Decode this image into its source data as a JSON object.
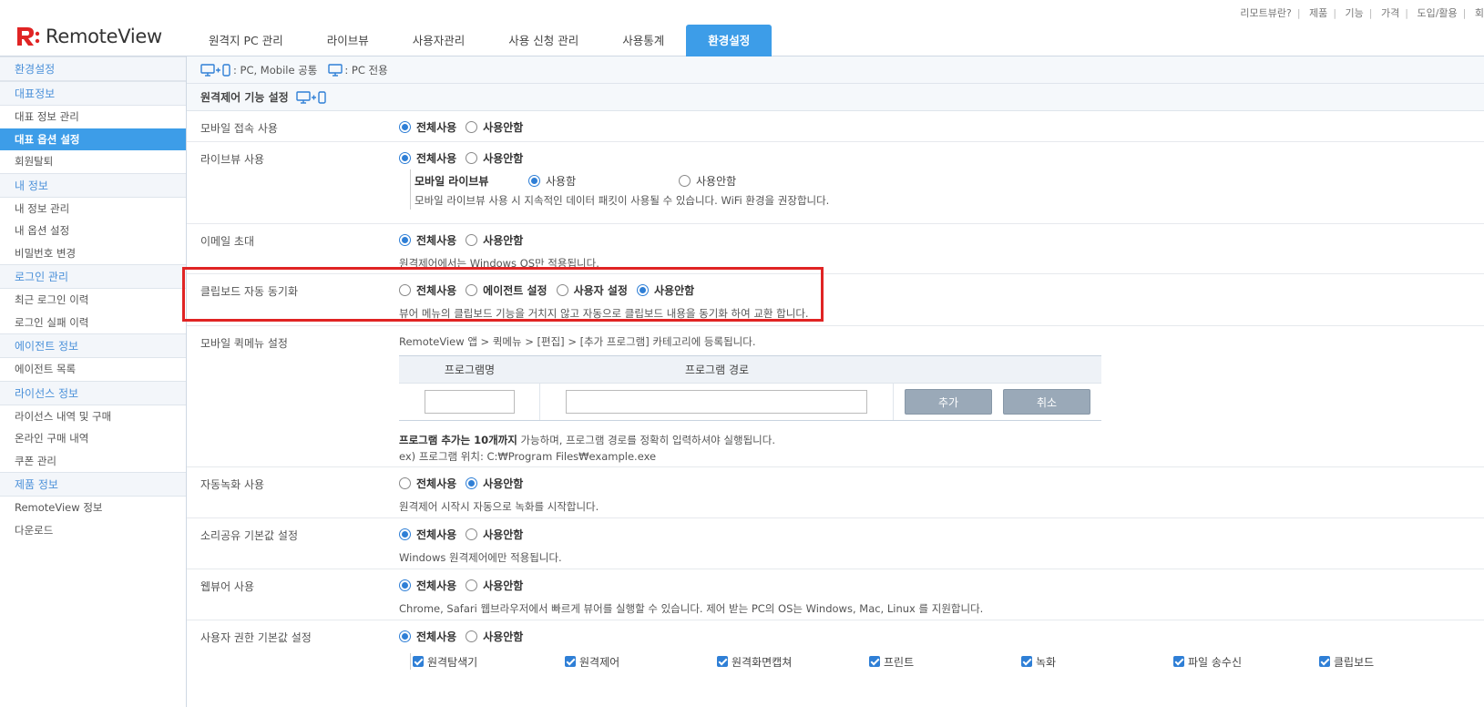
{
  "header": {
    "logo_text": "RemoteView",
    "top_links": [
      "리모트뷰란?",
      "제품",
      "기능",
      "가격",
      "도입/활용",
      "회"
    ],
    "nav": [
      {
        "label": "원격지 PC 관리",
        "active": false
      },
      {
        "label": "라이브뷰",
        "active": false
      },
      {
        "label": "사용자관리",
        "active": false
      },
      {
        "label": "사용 신청 관리",
        "active": false
      },
      {
        "label": "사용통계",
        "active": false
      },
      {
        "label": "환경설정",
        "active": true
      }
    ],
    "accent_color": "#3d9de8"
  },
  "sidebar": {
    "title": "환경설정",
    "sections": [
      {
        "title": "대표정보",
        "items": [
          {
            "label": "대표 정보 관리",
            "active": false
          },
          {
            "label": "대표 옵션 설정",
            "active": true
          },
          {
            "label": "회원탈퇴",
            "active": false
          }
        ]
      },
      {
        "title": "내 정보",
        "items": [
          {
            "label": "내 정보 관리",
            "active": false
          },
          {
            "label": "내 옵션 설정",
            "active": false
          },
          {
            "label": "비밀번호 변경",
            "active": false
          }
        ]
      },
      {
        "title": "로그인 관리",
        "items": [
          {
            "label": "최근 로그인 이력",
            "active": false
          },
          {
            "label": "로그인 실패 이력",
            "active": false
          }
        ]
      },
      {
        "title": "에이전트 정보",
        "items": [
          {
            "label": "에이전트 목록",
            "active": false
          }
        ]
      },
      {
        "title": "라이선스 정보",
        "items": [
          {
            "label": "라이선스 내역 및 구매",
            "active": false
          },
          {
            "label": "온라인 구매 내역",
            "active": false
          },
          {
            "label": "쿠폰 관리",
            "active": false
          }
        ]
      },
      {
        "title": "제품 정보",
        "items": [
          {
            "label": "RemoteView 정보",
            "active": false
          },
          {
            "label": "다운로드",
            "active": false
          }
        ]
      }
    ]
  },
  "legend": {
    "pc_mobile": ": PC, Mobile 공통",
    "pc_only": ": PC 전용"
  },
  "section_title": "원격제어 기능 설정",
  "rows": {
    "mobile_access": {
      "label": "모바일 접속 사용",
      "opt_all": "전체사용",
      "opt_none": "사용안함"
    },
    "liveview": {
      "label": "라이브뷰 사용",
      "opt_all": "전체사용",
      "opt_none": "사용안함",
      "sub_label": "모바일 라이브뷰",
      "sub_opt_use": "사용함",
      "sub_opt_none": "사용안함",
      "sub_desc": "모바일 라이브뷰 사용 시 지속적인 데이터 패킷이 사용될 수 있습니다. WiFi 환경을 권장합니다."
    },
    "email_invite": {
      "label": "이메일 초대",
      "opt_all": "전체사용",
      "opt_none": "사용안함",
      "desc": "원격제어에서는 Windows OS만 적용됩니다."
    },
    "clipboard": {
      "label": "클립보드 자동 동기화",
      "opt_all": "전체사용",
      "opt_agent": "에이전트 설정",
      "opt_user": "사용자 설정",
      "opt_none": "사용안함",
      "desc": "뷰어 메뉴의 클립보드 기능을 거치지 않고 자동으로 클립보드 내용을 동기화 하여 교환 합니다."
    },
    "quick_menu": {
      "label": "모바일 퀵메뉴 설정",
      "path": "RemoteView 앱 > 퀵메뉴 > [편집] > [추가 프로그램] 카테고리에 등록됩니다.",
      "col_name": "프로그램명",
      "col_path": "프로그램 경로",
      "add_button": "추가",
      "cancel_button": "취소",
      "note_bold": "프로그램 추가는 10개까지",
      "note_rest": " 가능하며, 프로그램 경로를 정확히 입력하셔야 실행됩니다.",
      "example": "ex) 프로그램 위치: C:₩Program Files₩example.exe"
    },
    "auto_record": {
      "label": "자동녹화 사용",
      "opt_all": "전체사용",
      "opt_none": "사용안함",
      "desc": "원격제어 시작시 자동으로 녹화를 시작합니다."
    },
    "sound_share": {
      "label": "소리공유 기본값 설정",
      "opt_all": "전체사용",
      "opt_none": "사용안함",
      "desc": "Windows 원격제어에만 적용됩니다."
    },
    "web_viewer": {
      "label": "웹뷰어 사용",
      "opt_all": "전체사용",
      "opt_none": "사용안함",
      "desc": "Chrome, Safari 웹브라우저에서 빠르게 뷰어를 실행할 수 있습니다. 제어 받는 PC의 OS는 Windows, Mac, Linux 를 지원합니다."
    },
    "user_perm": {
      "label": "사용자 권한 기본값 설정",
      "opt_all": "전체사용",
      "opt_none": "사용안함",
      "checks": [
        "원격탐색기",
        "원격제어",
        "원격화면캡쳐",
        "프린트",
        "녹화",
        "파일 송수신",
        "클립보드"
      ]
    }
  },
  "highlight_color": "#e02424"
}
